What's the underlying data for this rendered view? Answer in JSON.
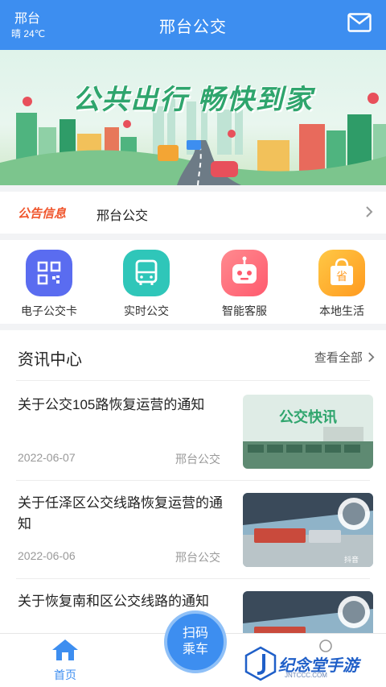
{
  "header": {
    "city": "邢台",
    "weather": "晴 24℃",
    "title": "邢台公交",
    "mail_icon": "mail-icon"
  },
  "banner": {
    "slogan": "公共出行  畅快到家"
  },
  "notice": {
    "tag": "公告信息",
    "text": "邢台公交"
  },
  "menu": {
    "items": [
      {
        "label": "电子公交卡",
        "icon": "qr-code-icon",
        "color": "#5a6cf0"
      },
      {
        "label": "实时公交",
        "icon": "bus-icon",
        "color": "#2fc6b9"
      },
      {
        "label": "智能客服",
        "icon": "robot-icon",
        "color": "#ff6f7a"
      },
      {
        "label": "本地生活",
        "icon": "shopping-bag-icon",
        "color": "#ffb020"
      }
    ]
  },
  "news": {
    "title": "资讯中心",
    "view_all": "查看全部",
    "articles": [
      {
        "title": "关于公交105路恢复运营的通知",
        "date": "2022-06-07",
        "source": "邢台公交",
        "thumb_text": "公交快讯"
      },
      {
        "title": "关于任泽区公交线路恢复运营的通知",
        "date": "2022-06-06",
        "source": "邢台公交",
        "thumb_text": "抖音"
      },
      {
        "title": "关于恢复南和区公交线路的通知",
        "date": "",
        "source": "",
        "thumb_text": ""
      }
    ]
  },
  "tabbar": {
    "home_label": "首页",
    "scan_line1": "扫码",
    "scan_line2": "乘车"
  },
  "watermark": {
    "text": "纪念堂手游",
    "sub": "JNTCCC.COM"
  },
  "colors": {
    "primary": "#3d8ef0",
    "notice_tag": "#f0562d",
    "slogan": "#2fa56d"
  }
}
